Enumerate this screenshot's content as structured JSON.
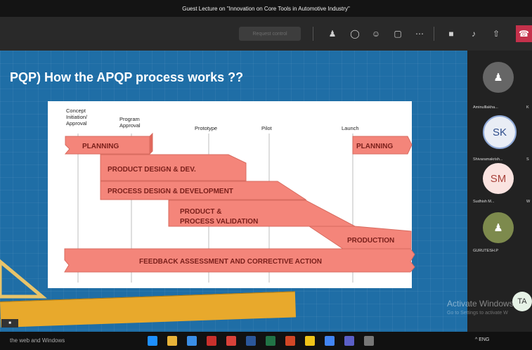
{
  "window": {
    "title": "Guest Lecture on \"Innovation on Core Tools in Automotive Industry\""
  },
  "toolbar": {
    "share_label": "Request control",
    "icons": [
      "participants-icon",
      "chat-icon",
      "reactions-icon",
      "rooms-icon",
      "more-icon",
      "camera-off-icon",
      "mic-off-icon",
      "share-tray-icon",
      "leave-icon"
    ]
  },
  "slide": {
    "title": "PQP) How the APQP process works ??",
    "phases": [
      "Concept Initiation/ Approval",
      "Program Approval",
      "Prototype",
      "Pilot",
      "Launch"
    ],
    "bars": {
      "planning_left": "PLANNING",
      "planning_right": "PLANNING",
      "product_design": "PRODUCT DESIGN & DEV.",
      "process_design": "PROCESS DESIGN & DEVELOPMENT",
      "validation_1": "PRODUCT &",
      "validation_2": "PROCESS VALIDATION",
      "production": "PRODUCTION",
      "feedback": "FEEDBACK ASSESSMENT AND CORRECTIVE ACTION"
    }
  },
  "participants": [
    {
      "name": "Aminulllakha...",
      "initials": "",
      "next": "K"
    },
    {
      "name": "Shivaramakrish...",
      "initials": "SK",
      "next": "S"
    },
    {
      "name": "Sudhish M...",
      "initials": "SM",
      "next": "W"
    },
    {
      "name": "GURUTESH.P",
      "initials": "",
      "next": ""
    }
  ],
  "watermark": {
    "line1": "Activate Windows",
    "line2": "Go to Settings to activate W"
  },
  "self_avatar": "TA",
  "taskbar": {
    "search": "the web and Windows",
    "tray": "^ ENG"
  },
  "colors": {
    "bar_fill": "#f4857a",
    "bar_dark": "#e2675b",
    "stage_blue": "#1f6ea6"
  }
}
